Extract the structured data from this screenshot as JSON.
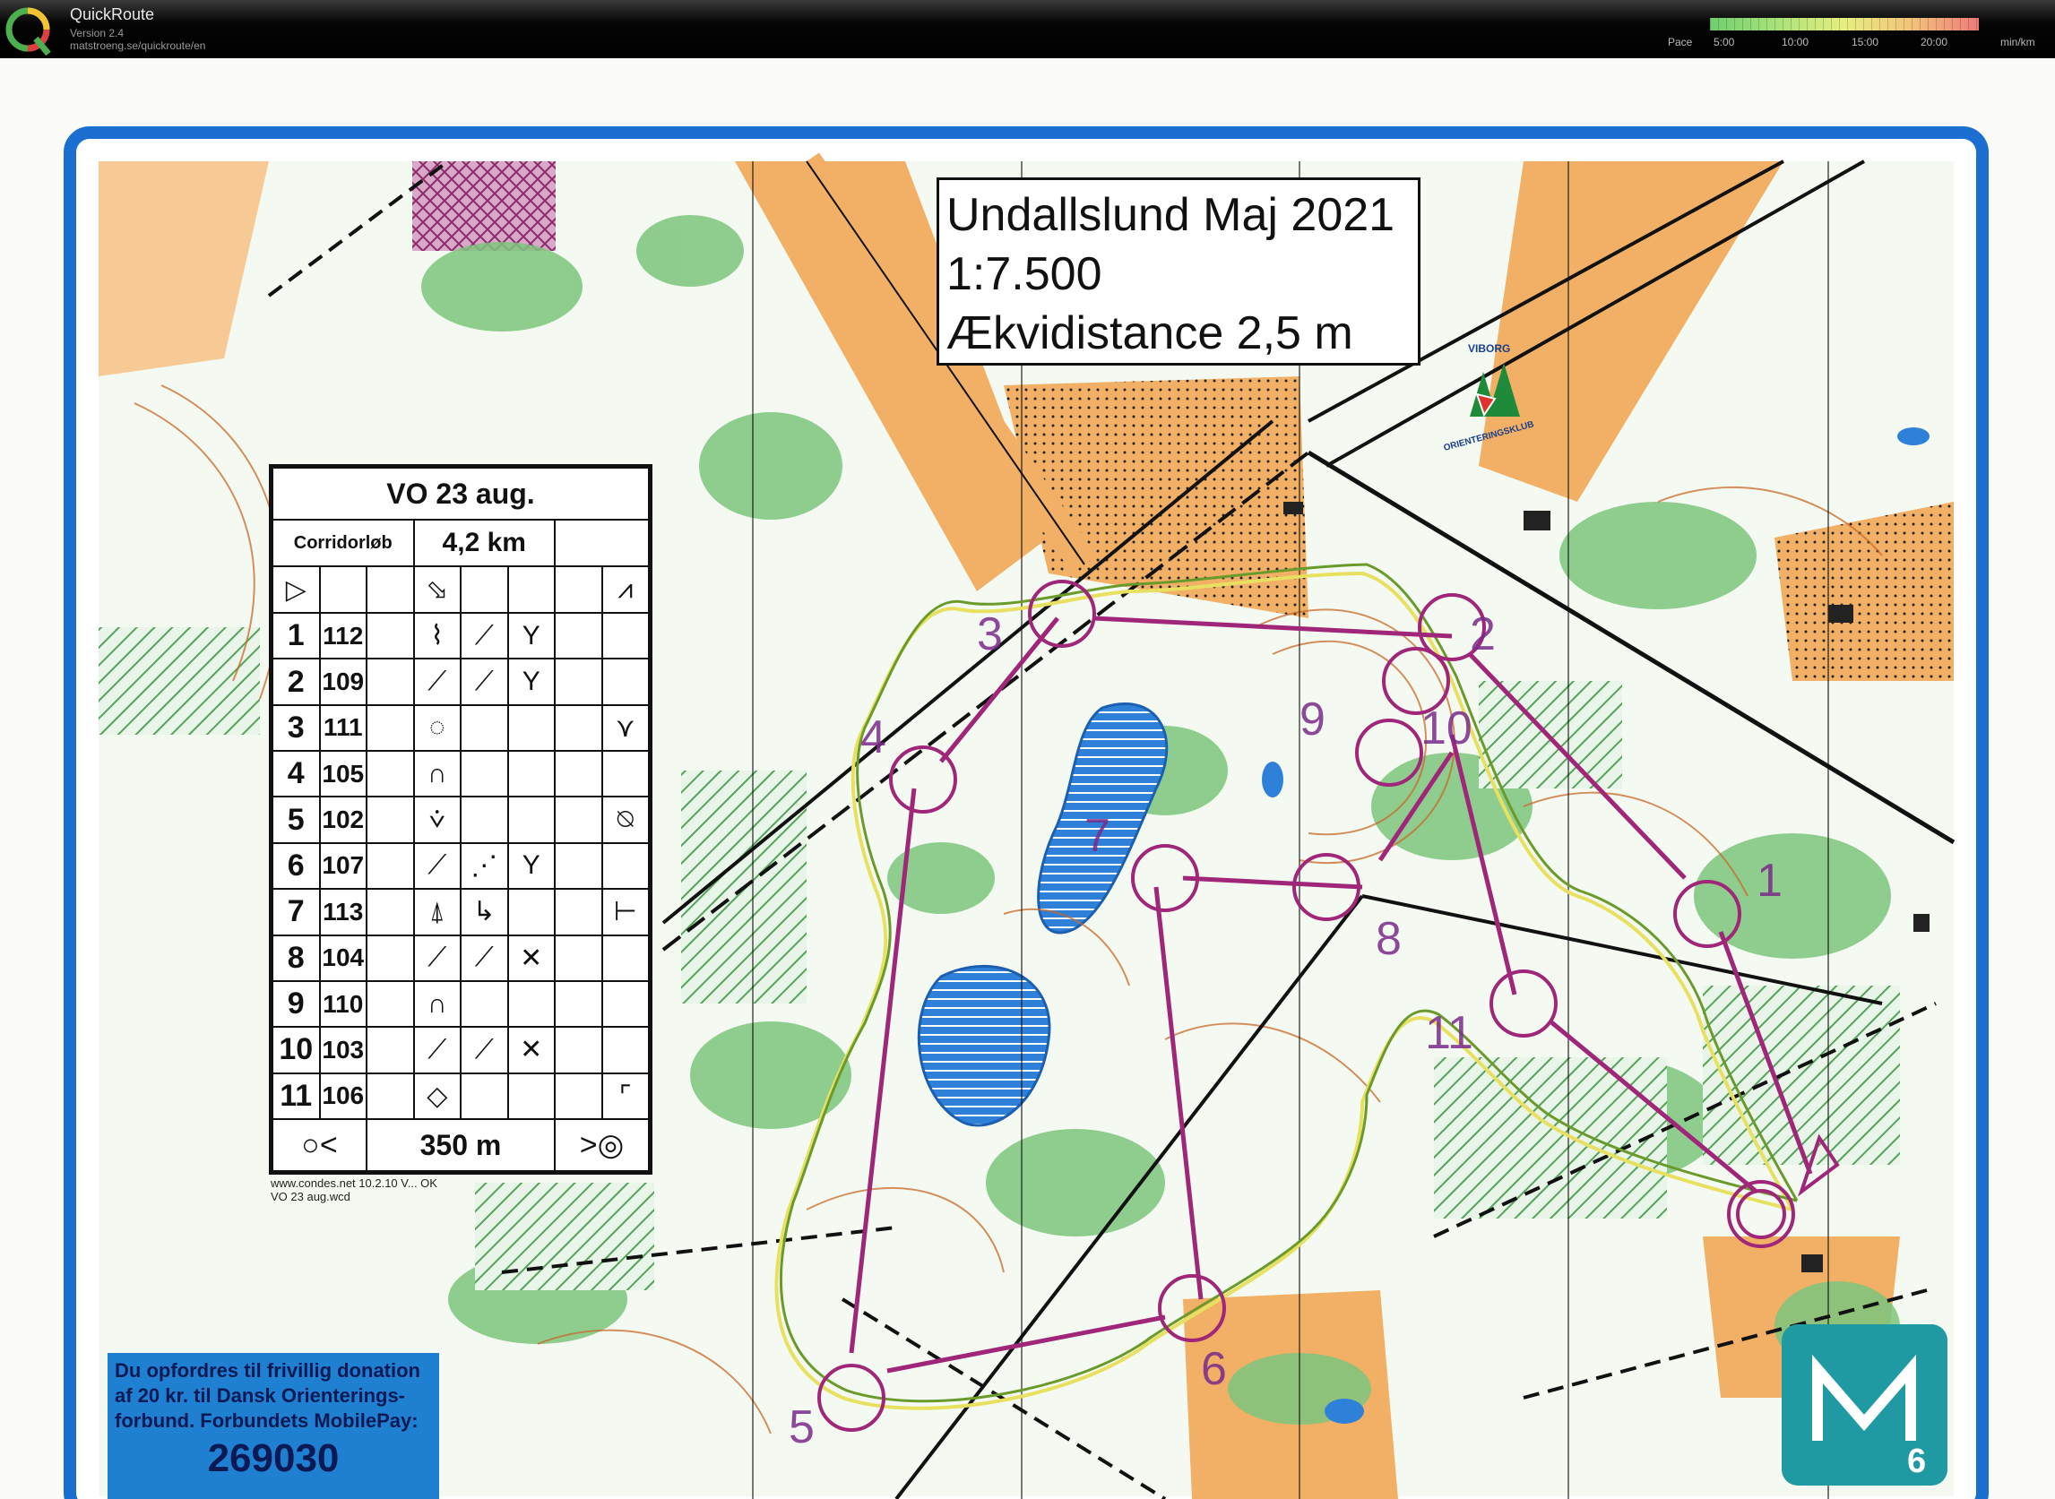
{
  "app": {
    "name": "QuickRoute",
    "version": "Version 2.4",
    "url": "matstroeng.se/quickroute/en"
  },
  "pace_scale": {
    "label": "Pace",
    "ticks": [
      "5:00",
      "10:00",
      "15:00",
      "20:00"
    ],
    "unit": "min/km"
  },
  "map_title": {
    "line1": "Undallslund Maj 2021",
    "line2": "1:7.500",
    "line3": "Ækvidistance 2,5 m"
  },
  "club_logo": {
    "top_text": "VIBORG",
    "bottom_text": "ORIENTERINGSKLUB"
  },
  "description_sheet": {
    "event": "VO 23 aug.",
    "course": "Corridorløb",
    "length": "4,2 km",
    "controls": [
      {
        "num": "1",
        "code": "112"
      },
      {
        "num": "2",
        "code": "109"
      },
      {
        "num": "3",
        "code": "111"
      },
      {
        "num": "4",
        "code": "105"
      },
      {
        "num": "5",
        "code": "102"
      },
      {
        "num": "6",
        "code": "107"
      },
      {
        "num": "7",
        "code": "113"
      },
      {
        "num": "8",
        "code": "104"
      },
      {
        "num": "9",
        "code": "110"
      },
      {
        "num": "10",
        "code": "103"
      },
      {
        "num": "11",
        "code": "106"
      }
    ],
    "finish_distance": "350 m",
    "footer_line1": "www.condes.net 10.2.10 V... OK",
    "footer_line2": "VO 23 aug.wcd"
  },
  "map_control_labels": [
    "1",
    "2",
    "3",
    "4",
    "5",
    "6",
    "7",
    "8",
    "9",
    "10",
    "11"
  ],
  "donation": {
    "line1": "Du opfordres til frivillig donation",
    "line2": "af 20 kr. til Dansk Orienterings-",
    "line3": "forbund. Forbundets MobilePay:",
    "number": "269030"
  },
  "badge": {
    "letter": "M",
    "sub": "6"
  },
  "colors": {
    "course": "#a0267a",
    "route_green": "#6a9a2a",
    "route_yellow": "#e8e060",
    "forest": "#7cc47c",
    "open_land": "#f2b066",
    "water": "#2f80d8",
    "frame_blue": "#1a6fd0",
    "contour": "#c86a2a"
  }
}
